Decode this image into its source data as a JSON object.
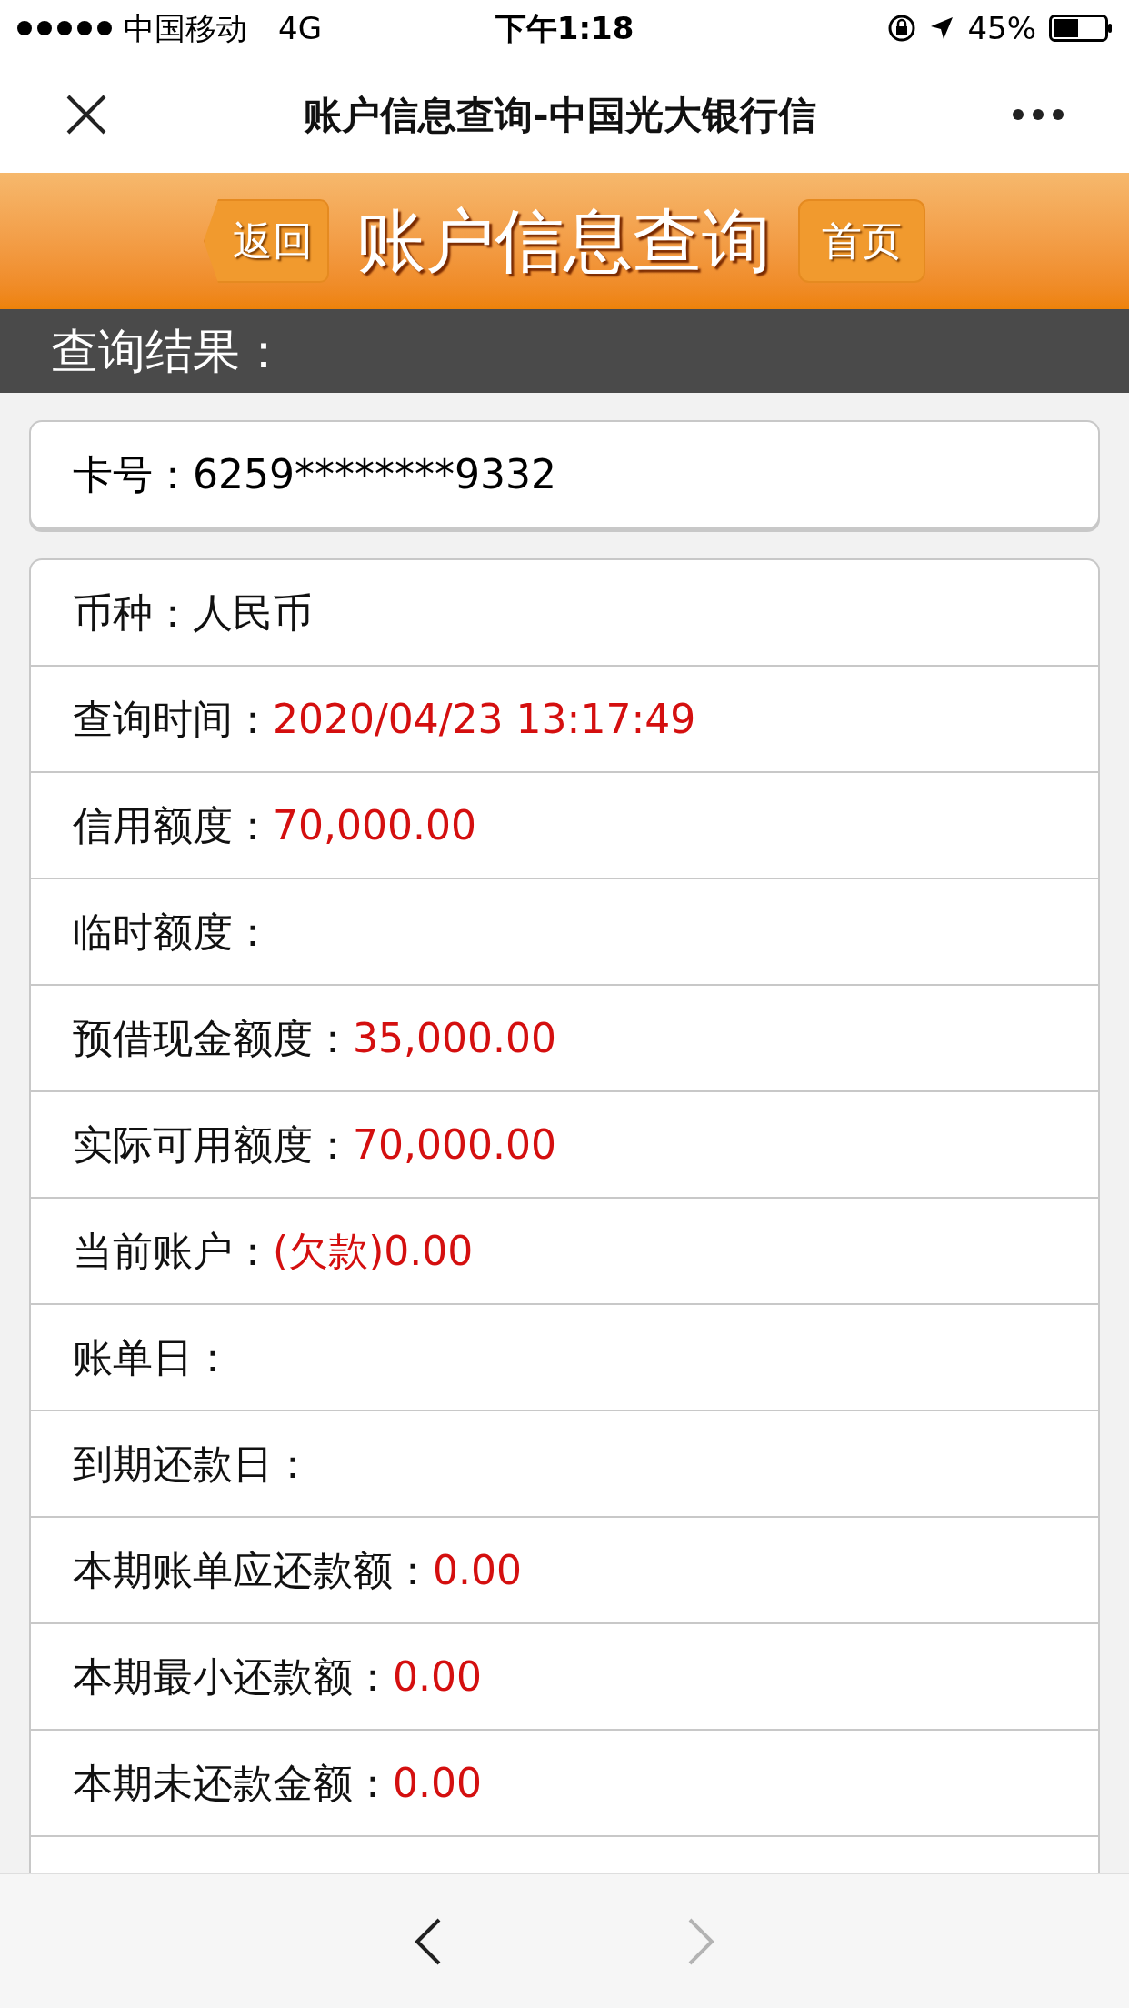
{
  "status_bar": {
    "signal_carrier": "中国移动",
    "network": "4G",
    "time": "下午1:18",
    "battery": "45%"
  },
  "nav_bar": {
    "title": "账户信息查询-中国光大银行信"
  },
  "header": {
    "back": "返回",
    "title": "账户信息查询",
    "home": "首页"
  },
  "section_title": "查询结果：",
  "card_number": {
    "label": "卡号：",
    "value": "6259********9332"
  },
  "rows": [
    {
      "kind": "text",
      "label": "币种：",
      "value": "人民币"
    },
    {
      "kind": "amount",
      "label": "查询时间：",
      "value": "2020/04/23 13:17:49"
    },
    {
      "kind": "amount",
      "label": "信用额度：",
      "value": "70,000.00"
    },
    {
      "kind": "empty",
      "label": "临时额度："
    },
    {
      "kind": "amount",
      "label": "预借现金额度：",
      "value": "35,000.00"
    },
    {
      "kind": "amount",
      "label": "实际可用额度：",
      "value": "70,000.00"
    },
    {
      "kind": "amount",
      "label": "当前账户：",
      "value": "(欠款)0.00"
    },
    {
      "kind": "empty",
      "label": "账单日："
    },
    {
      "kind": "empty",
      "label": "到期还款日："
    },
    {
      "kind": "amount",
      "label": "本期账单应还款额：",
      "value": "0.00"
    },
    {
      "kind": "amount",
      "label": "本期最小还款额：",
      "value": "0.00"
    },
    {
      "kind": "amount",
      "label": "本期未还款金额：",
      "value": "0.00"
    }
  ],
  "toolbar": {
    "back_disabled": false,
    "forward_disabled": true
  }
}
